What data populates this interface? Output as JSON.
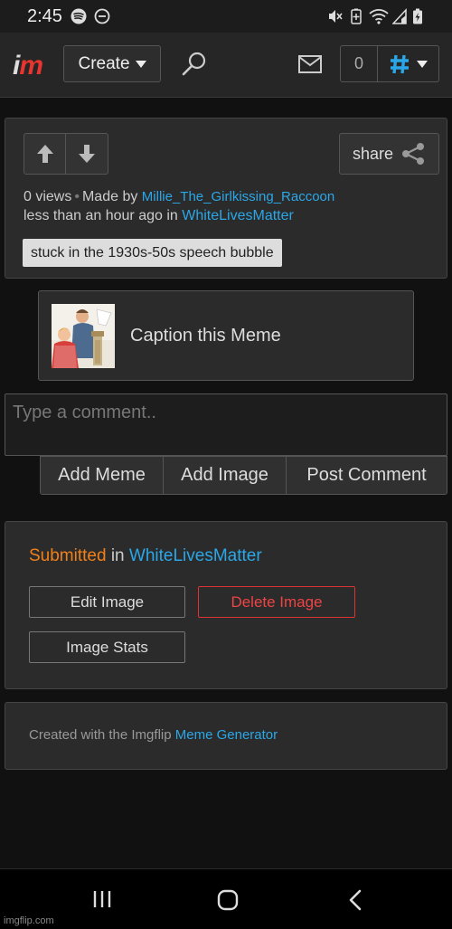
{
  "status_bar": {
    "time": "2:45",
    "icons": [
      "spotify-icon",
      "do-not-disturb-icon",
      "mute-icon",
      "battery-saver-icon",
      "wifi-icon",
      "signal-icon",
      "battery-icon"
    ]
  },
  "nav": {
    "logo_i": "i",
    "logo_m": "m",
    "create_label": "Create",
    "notification_count": "0",
    "colors": {
      "accent": "#2ba7e8",
      "logo": "#e8352f"
    }
  },
  "post": {
    "share_label": "share",
    "views": "0 views",
    "made_by_label": "Made by",
    "author": "Millie_The_Girlkissing_Raccoon",
    "time_text": "less than an hour ago in",
    "stream": "WhiteLivesMatter",
    "tag": "stuck in the 1930s-50s speech bubble"
  },
  "caption": {
    "label": "Caption this Meme"
  },
  "comment": {
    "placeholder": "Type a comment..",
    "buttons": [
      "Add Meme",
      "Add Image",
      "Post Comment"
    ]
  },
  "owner_panel": {
    "submitted_label": "Submitted",
    "in_label": "in",
    "stream": "WhiteLivesMatter",
    "edit_label": "Edit Image",
    "delete_label": "Delete Image",
    "stats_label": "Image Stats"
  },
  "footer": {
    "created_text": "Created with the Imgflip",
    "generator_link": "Meme Generator"
  },
  "watermark": "imgflip.com"
}
